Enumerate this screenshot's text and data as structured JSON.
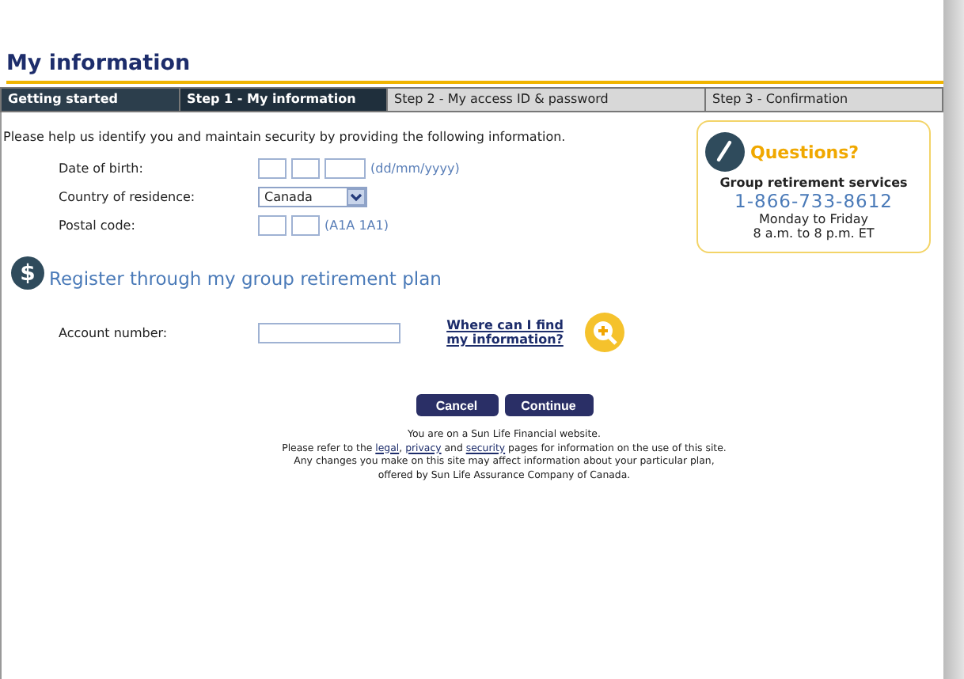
{
  "title": "My information",
  "tabs": [
    {
      "label": "Getting started",
      "selected": false,
      "completed": true
    },
    {
      "label": "Step 1 - My information",
      "selected": true,
      "completed": false
    },
    {
      "label": "Step 2 - My access ID & password",
      "selected": false,
      "completed": false
    },
    {
      "label": "Step 3 - Confirmation",
      "selected": false,
      "completed": false
    }
  ],
  "intro": "Please help us identify you and maintain security by providing the following information.",
  "fields": [
    {
      "label": "Date of birth:",
      "kind": "date",
      "hint": "(dd/mm/yyyy)"
    },
    {
      "label": "Country of residence:",
      "kind": "select",
      "value": "Canada"
    },
    {
      "label": "Postal code:",
      "kind": "postal",
      "hint": "(A1A 1A1)"
    }
  ],
  "questions": {
    "title": "Questions?",
    "service": "Group retirement services",
    "phone": "1-866-733-8612",
    "days": "Monday to Friday",
    "hours": "8 a.m. to 8 p.m. ET"
  },
  "register": {
    "heading": "Register through my group retirement plan",
    "icon_text": "$",
    "label": "Account number:",
    "link": "Where can I find my information?"
  },
  "buttons": [
    "Cancel",
    "Continue"
  ],
  "footer": {
    "line1": "You are on a Sun Life Financial website.",
    "line2": [
      {
        "kind": "text",
        "text": "Please refer to the "
      },
      {
        "kind": "link",
        "text": "legal"
      },
      {
        "kind": "text",
        "text": ", "
      },
      {
        "kind": "link",
        "text": "privacy"
      },
      {
        "kind": "text",
        "text": " and "
      },
      {
        "kind": "link",
        "text": "security"
      },
      {
        "kind": "text",
        "text": " pages for information on the use of this site."
      }
    ],
    "line3": "Any changes you make on this site may affect information about your particular plan,",
    "line4": "offered by Sun Life Assurance Company of Canada."
  }
}
